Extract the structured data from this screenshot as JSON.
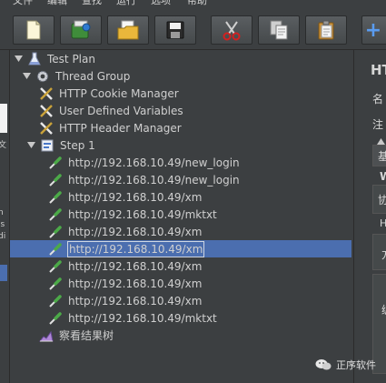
{
  "menu": [
    "文件",
    "编辑",
    "查找",
    "运行",
    "选项",
    "帮助"
  ],
  "toolbar": {
    "buttons": [
      {
        "name": "new-button",
        "icon": "new-file-icon"
      },
      {
        "name": "templates-button",
        "icon": "templates-icon"
      },
      {
        "name": "open-button",
        "icon": "open-folder-icon"
      },
      {
        "name": "save-button",
        "icon": "save-icon"
      },
      {
        "name": "cut-button",
        "icon": "scissors-icon"
      },
      {
        "name": "copy-button",
        "icon": "copy-icon"
      },
      {
        "name": "paste-button",
        "icon": "paste-icon"
      }
    ],
    "add_label": "+"
  },
  "tree": {
    "test_plan": "Test Plan",
    "thread_group": "Thread Group",
    "cookie_manager": "HTTP Cookie Manager",
    "user_vars": "User Defined Variables",
    "header_manager": "HTTP Header Manager",
    "step": "Step 1",
    "samplers": [
      "http://192.168.10.49/new_login",
      "http://192.168.10.49/new_login",
      "http://192.168.10.49/xm",
      "http://192.168.10.49/mktxt",
      "http://192.168.10.49/xm",
      "http://192.168.10.49/xm",
      "http://192.168.10.49/xm",
      "http://192.168.10.49/xm",
      "http://192.168.10.49/xm",
      "http://192.168.10.49/mktxt"
    ],
    "selected_index": 5,
    "listener": "察看结果树"
  },
  "left_strip": {
    "fragments": [
      "2",
      "文",
      "n",
      "is",
      "di"
    ]
  },
  "right_panel": {
    "title": "HTT",
    "name_label": "名",
    "comment_label": "注",
    "tab_basic": "基",
    "w_label": "W",
    "protocol_label": "协",
    "h_label": "H",
    "f_label": "方",
    "a_label": "编"
  },
  "watermark": {
    "text": "正序软件"
  },
  "colors": {
    "background": "#3c3f41",
    "selection": "#4b6eaf",
    "text": "#cfcfcf"
  }
}
